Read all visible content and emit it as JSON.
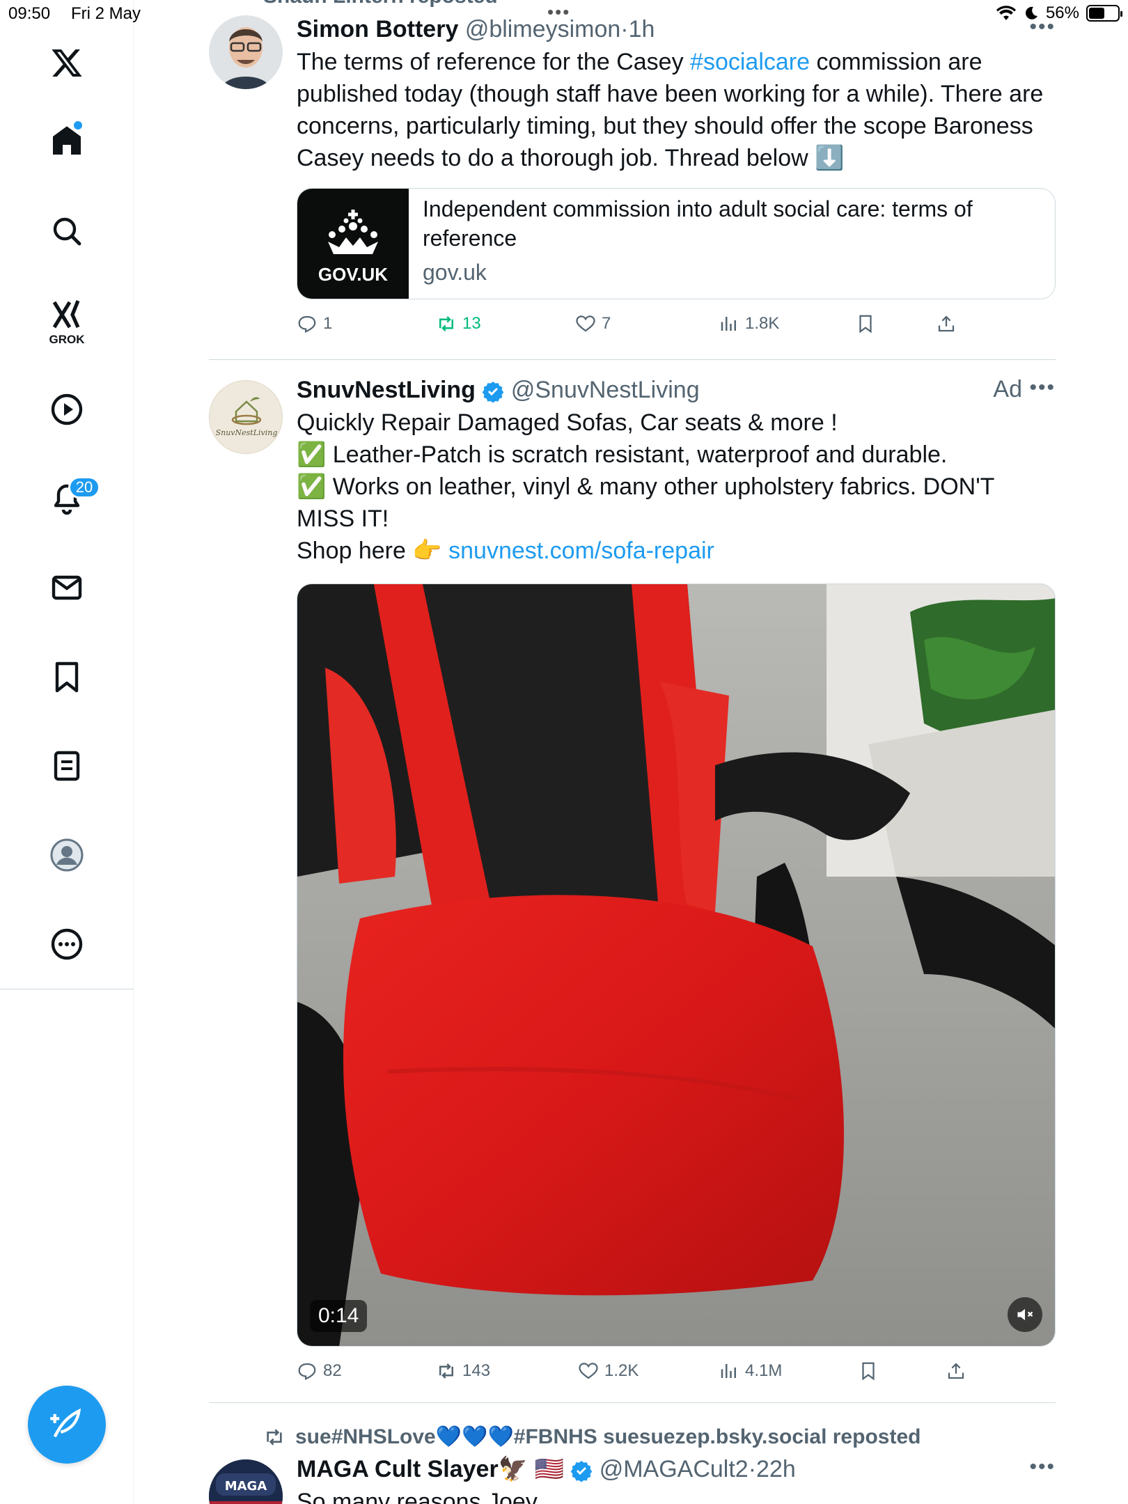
{
  "status_bar": {
    "time": "09:50",
    "date": "Fri 2 May",
    "battery": "56%",
    "battery_fraction": 0.56
  },
  "sidebar": {
    "grok_label": "GROK",
    "notifications_count": "20",
    "items": [
      "x-logo",
      "home",
      "search",
      "grok",
      "videos",
      "notifications",
      "messages",
      "bookmarks",
      "lists",
      "profile",
      "more"
    ]
  },
  "top_cut_text": "Shaun Lintern reposted",
  "tweets": [
    {
      "display_name": "Simon Bottery",
      "handle": "@blimeysimon",
      "sep": "·",
      "time": "1h",
      "text_parts": [
        "The terms of reference for the Casey ",
        "#socialcare",
        " commission are published today (though staff have been working for a while). There are concerns, particularly timing, but they should offer the scope Baroness Casey needs to do a thorough job. Thread below ⬇️"
      ],
      "card": {
        "thumb_label": "GOV.UK",
        "title": "Independent commission into adult social care: terms of reference",
        "domain": "gov.uk"
      },
      "stats": {
        "replies": "1",
        "reposts": "13",
        "likes": "7",
        "views": "1.8K"
      }
    },
    {
      "display_name": "SnuvNestLiving",
      "handle": "@SnuvNestLiving",
      "ad_label": "Ad",
      "avatar_text": "SnuvNestLiving",
      "lines": {
        "l1": "Quickly Repair Damaged Sofas, Car seats & more !",
        "l2": "✅ Leather-Patch is scratch resistant, waterproof and durable.",
        "l3": "✅ Works on leather, vinyl & many other upholstery fabrics. DON'T MISS IT!",
        "l4_prefix": "Shop here 👉 ",
        "l4_link": "snuvnest.com/sofa-repair"
      },
      "video_duration": "0:14",
      "stats": {
        "replies": "82",
        "reposts": "143",
        "likes": "1.2K",
        "views": "4.1M"
      }
    },
    {
      "repost_by": "sue#NHSLove💙💙💙#FBNHS suesuezep.bsky.social reposted",
      "display_name": "MAGA Cult Slayer🦅 🇺🇸",
      "handle": "@MAGACult2",
      "sep": "·",
      "time": "22h",
      "avatar_text": "MAGA",
      "text": "So many reasons Joey"
    }
  ],
  "colors": {
    "accent": "#1d9bf0",
    "text": "#0f1419",
    "muted": "#536471",
    "repost_green": "#00ba7c",
    "border": "#cfd9de"
  }
}
